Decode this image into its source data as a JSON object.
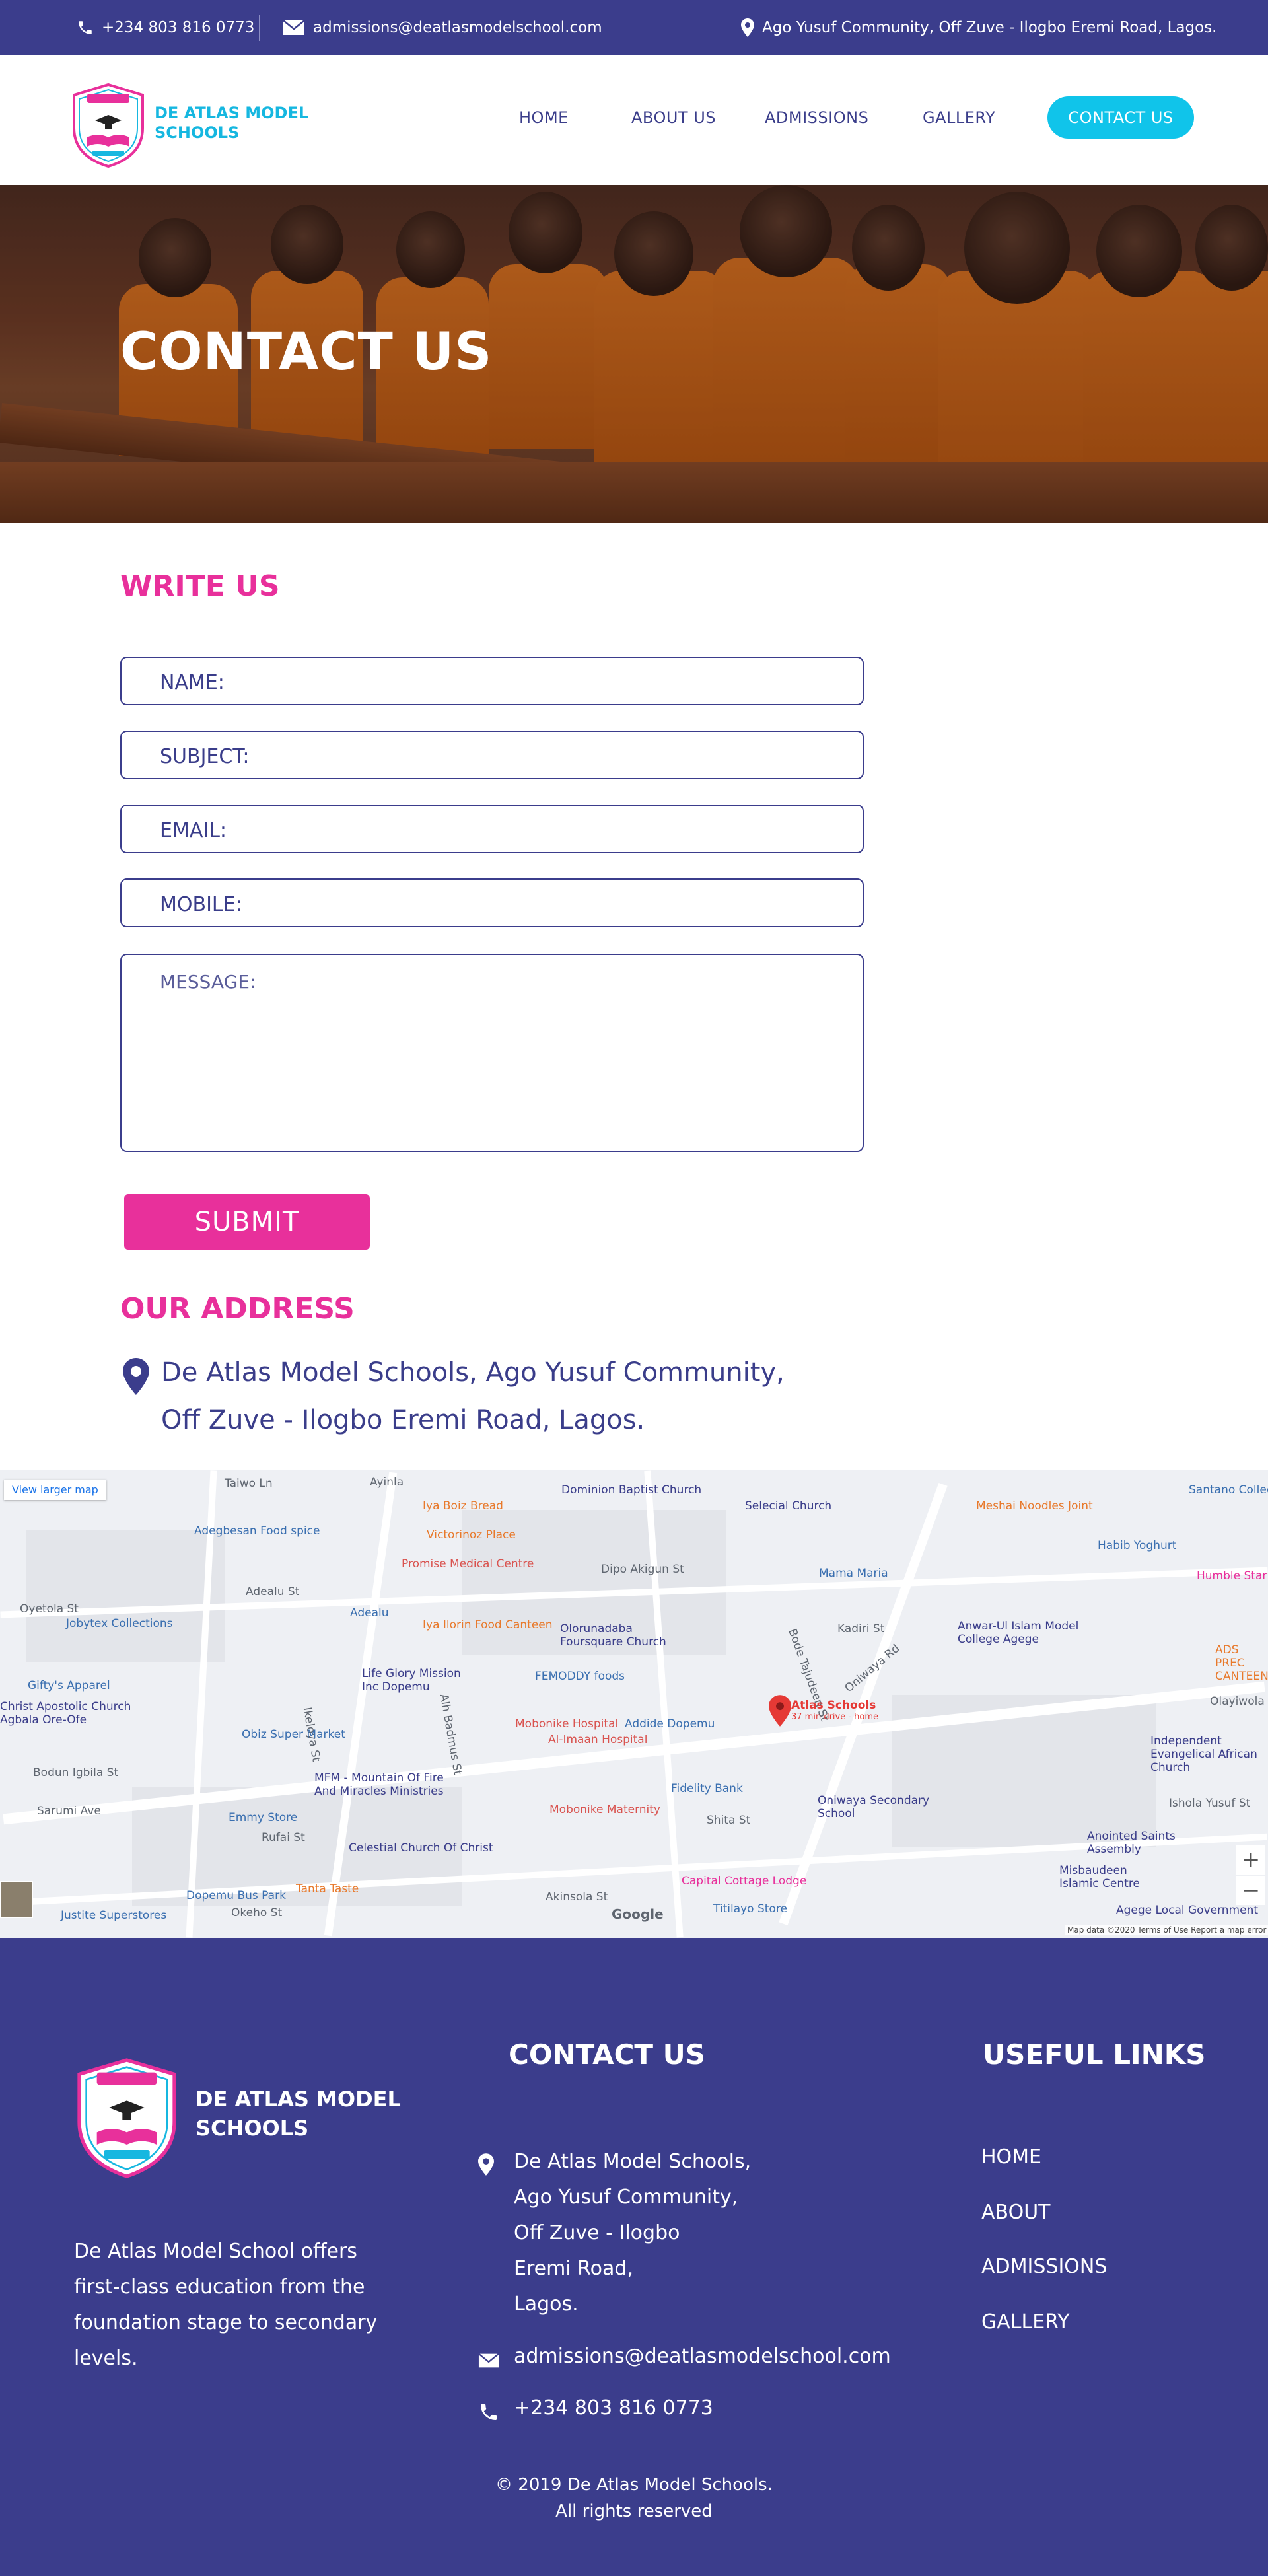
{
  "topbar": {
    "phone": "+234 803 816 0773",
    "email": "admissions@deatlasmodelschool.com",
    "address": "Ago Yusuf Community, Off Zuve - Ilogbo Eremi Road, Lagos."
  },
  "header": {
    "brand_line1": "DE ATLAS MODEL",
    "brand_line2": "SCHOOLS",
    "logo_text": "DE ATLAS MODEL SCHOOLS",
    "nav": [
      "HOME",
      "ABOUT US",
      "ADMISSIONS",
      "GALLERY"
    ],
    "cta": "CONTACT US"
  },
  "hero": {
    "title": "CONTACT US"
  },
  "form": {
    "title": "WRITE US",
    "name_placeholder": "NAME:",
    "subject_placeholder": "SUBJECT:",
    "email_placeholder": "EMAIL:",
    "mobile_placeholder": "MOBILE:",
    "message_placeholder": "MESSAGE:",
    "submit": "SUBMIT"
  },
  "address_section": {
    "title": "OUR ADDRESS",
    "line1": "De Atlas Model Schools, Ago Yusuf Community,",
    "line2": "Off Zuve - Ilogbo Eremi Road, Lagos."
  },
  "map": {
    "view_larger": "View larger map",
    "marker_label": "Atlas Schools",
    "marker_sub": "37 min drive - home",
    "zoom_in": "+",
    "zoom_out": "−",
    "attribution": "Map data ©2020   Terms of Use   Report a map error",
    "google": "Google",
    "places": [
      {
        "name": "Dominion Baptist Church",
        "color": "#5f6670"
      },
      {
        "name": "Iya Boiz Bread",
        "color": "#e8792b"
      },
      {
        "name": "Victorinoz Place",
        "color": "#e8792b"
      },
      {
        "name": "Selecial Church",
        "color": "#5f6670"
      },
      {
        "name": "Meshai Noodles Joint",
        "color": "#e8792b"
      },
      {
        "name": "Habib Yoghurt",
        "color": "#3a6fb0"
      },
      {
        "name": "Adegbesan Food spice",
        "color": "#3a6fb0"
      },
      {
        "name": "Promise Medical Centre",
        "color": "#d9534f"
      },
      {
        "name": "Mama Maria",
        "color": "#3a6fb0"
      },
      {
        "name": "Jobytex Collections",
        "color": "#3a6fb0"
      },
      {
        "name": "Iya Ilorin Food Canteen",
        "color": "#e8792b"
      },
      {
        "name": "Olorunadaba Foursquare Church",
        "color": "#5f6670"
      },
      {
        "name": "Anwar-Ul Islam Model College Agege",
        "color": "#5f6670"
      },
      {
        "name": "Gifty's Apparel",
        "color": "#3a6fb0"
      },
      {
        "name": "Life Glory Mission Inc Dopemu",
        "color": "#5f6670"
      },
      {
        "name": "FEMODDY foods",
        "color": "#3a6fb0"
      },
      {
        "name": "Christ Apostolic Church Agbala Ore-Ofe",
        "color": "#5f6670"
      },
      {
        "name": "Mobonike Hospital",
        "color": "#d9534f"
      },
      {
        "name": "Addide Dopemu",
        "color": "#3a6fb0"
      },
      {
        "name": "Al-Imaan Hospital",
        "color": "#d9534f"
      },
      {
        "name": "Obiz Super Market",
        "color": "#3a6fb0"
      },
      {
        "name": "MFM - Mountain Of Fire And Miracles Ministries",
        "color": "#5f6670"
      },
      {
        "name": "Fidelity Bank",
        "color": "#3a6fb0"
      },
      {
        "name": "Oniwaya Secondary School",
        "color": "#5f6670"
      },
      {
        "name": "Emmy Store",
        "color": "#3a6fb0"
      },
      {
        "name": "Mobonike Maternity",
        "color": "#d9534f"
      },
      {
        "name": "Independent Evangelical African Church",
        "color": "#5f6670"
      },
      {
        "name": "Celestial Church Of Christ",
        "color": "#5f6670"
      },
      {
        "name": "Anointed Saints Assembly",
        "color": "#5f6670"
      },
      {
        "name": "Capital Cottage Lodge",
        "color": "#e8309b"
      },
      {
        "name": "Misbaudeen Islamic Centre",
        "color": "#5f6670"
      },
      {
        "name": "Tanta Taste",
        "color": "#e8792b"
      },
      {
        "name": "Dopemu Bus Park",
        "color": "#3a6fb0"
      },
      {
        "name": "Titilayo Store",
        "color": "#3a6fb0"
      },
      {
        "name": "Justite Superstores",
        "color": "#3a6fb0"
      },
      {
        "name": "Agege Local Government",
        "color": "#5f6670"
      },
      {
        "name": "Humble Star",
        "color": "#e8309b"
      },
      {
        "name": "ADS PREC CANTEEN",
        "color": "#e8792b"
      },
      {
        "name": "Santano Collec",
        "color": "#3a6fb0"
      }
    ],
    "streets": [
      "Adealu St",
      "Oyetola St",
      "Adealu",
      "Ayinla",
      "Taiwo Ln",
      "Kadiri St",
      "Oniwaya Rd",
      "Bode Tajudeen St",
      "Ikeloya St",
      "Alh Badmus St",
      "Shita St",
      "Akinsola St",
      "Ishola Yusuf St",
      "Dipo Akigun St",
      "Rufai St",
      "Okeho St",
      "Sarumi Ave",
      "Bodun Igbila St",
      "Olayiwola St"
    ]
  },
  "footer": {
    "brand_line1": "DE ATLAS MODEL",
    "brand_line2": "SCHOOLS",
    "about": "De Atlas Model School offers first-class education from the foundation stage to secondary levels.",
    "contact_title": "CONTACT US",
    "contact_addr": [
      "De Atlas Model Schools,",
      "Ago Yusuf Community,",
      "Off Zuve - Ilogbo",
      "Eremi Road,",
      "Lagos."
    ],
    "contact_email": "admissions@deatlasmodelschool.com",
    "contact_phone": "+234 803 816 0773",
    "links_title": "USEFUL LINKS",
    "links": [
      "HOME",
      "ABOUT",
      "ADMISSIONS",
      "GALLERY"
    ],
    "copyright_line1": "2019 De Atlas Model Schools.",
    "copyright_line2": "All rights reserved"
  }
}
